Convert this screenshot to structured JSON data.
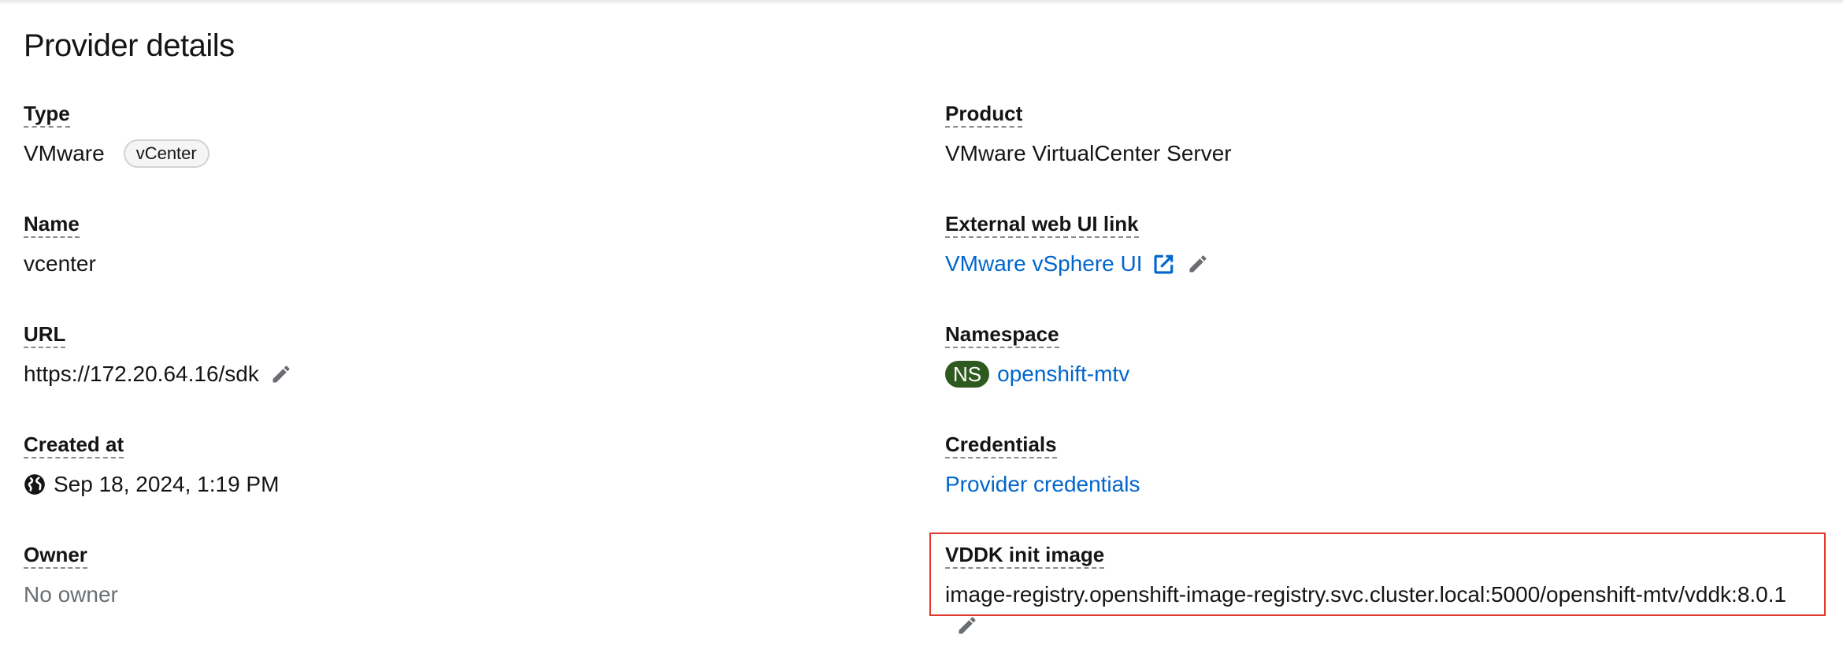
{
  "page": {
    "title": "Provider details"
  },
  "left": {
    "type": {
      "label": "Type",
      "value": "VMware",
      "badge": "vCenter"
    },
    "name": {
      "label": "Name",
      "value": "vcenter"
    },
    "url": {
      "label": "URL",
      "value": "https://172.20.64.16/sdk",
      "edit_icon": "pencil-icon"
    },
    "created_at": {
      "label": "Created at",
      "value": "Sep 18, 2024, 1:19 PM",
      "icon": "globe-icon"
    },
    "owner": {
      "label": "Owner",
      "value": "No owner"
    }
  },
  "right": {
    "product": {
      "label": "Product",
      "value": "VMware VirtualCenter Server"
    },
    "external_ui": {
      "label": "External web UI link",
      "link_text": "VMware vSphere UI",
      "icons": [
        "external-link-icon",
        "pencil-icon"
      ]
    },
    "namespace": {
      "label": "Namespace",
      "badge": "NS",
      "link_text": "openshift-mtv"
    },
    "credentials": {
      "label": "Credentials",
      "link_text": "Provider credentials"
    },
    "vddk": {
      "label": "VDDK init image",
      "value": "image-registry.openshift-image-registry.svc.cluster.local:5000/openshift-mtv/vddk:8.0.1",
      "edit_icon": "pencil-icon"
    }
  },
  "colors": {
    "link": "#0066cc",
    "text": "#151515",
    "muted": "#6a6e73",
    "ns_badge": "#2e5a1f",
    "highlight_border": "#e0382b",
    "icon": "#6a6e73"
  }
}
